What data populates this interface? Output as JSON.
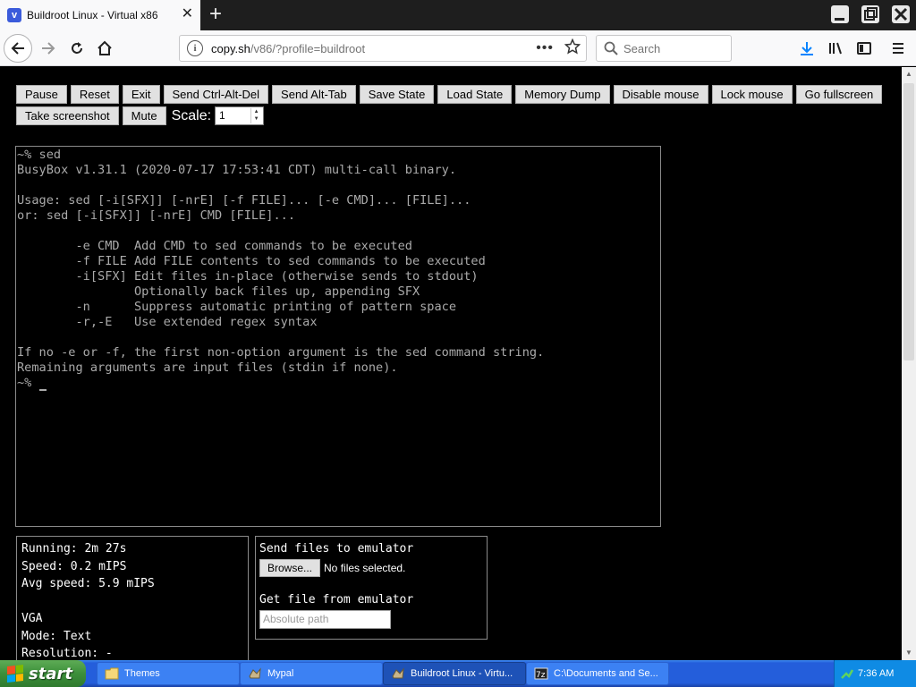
{
  "browser": {
    "tab_title": "Buildroot Linux - Virtual x86",
    "tab_favicon": "v86-icon",
    "url_host": "copy.sh",
    "url_path": "/v86/?profile=buildroot",
    "search_placeholder": "Search"
  },
  "toolbar": {
    "row1": [
      "Pause",
      "Reset",
      "Exit",
      "Send Ctrl-Alt-Del",
      "Send Alt-Tab",
      "Save State",
      "Load State",
      "Memory Dump",
      "Disable mouse",
      "Lock mouse",
      "Go fullscreen"
    ],
    "row2": [
      "Take screenshot",
      "Mute"
    ],
    "scale_label": "Scale:",
    "scale_value": "1"
  },
  "terminal": {
    "lines": [
      "~% sed",
      "BusyBox v1.31.1 (2020-07-17 17:53:41 CDT) multi-call binary.",
      "",
      "Usage: sed [-i[SFX]] [-nrE] [-f FILE]... [-e CMD]... [FILE]...",
      "or: sed [-i[SFX]] [-nrE] CMD [FILE]...",
      "",
      "        -e CMD  Add CMD to sed commands to be executed",
      "        -f FILE Add FILE contents to sed commands to be executed",
      "        -i[SFX] Edit files in-place (otherwise sends to stdout)",
      "                Optionally back files up, appending SFX",
      "        -n      Suppress automatic printing of pattern space",
      "        -r,-E   Use extended regex syntax",
      "",
      "If no -e or -f, the first non-option argument is the sed command string.",
      "Remaining arguments are input files (stdin if none).",
      "~% "
    ]
  },
  "stats": {
    "running": "Running: 2m 27s",
    "speed": "Speed: 0.2 mIPS",
    "avg_speed": "Avg speed: 5.9 mIPS",
    "vga_heading": "VGA",
    "mode": "Mode: Text",
    "resolution": "Resolution: -"
  },
  "files": {
    "send_heading": "Send files to emulator",
    "browse_label": "Browse...",
    "no_files": "No files selected.",
    "get_heading": "Get file from emulator",
    "path_placeholder": "Absolute path"
  },
  "taskbar": {
    "start_label": "start",
    "tasks": [
      "Themes",
      "Mypal",
      "Buildroot Linux - Virtu...",
      "C:\\Documents and Se..."
    ],
    "active_task": 2,
    "clock": "7:36 AM"
  }
}
